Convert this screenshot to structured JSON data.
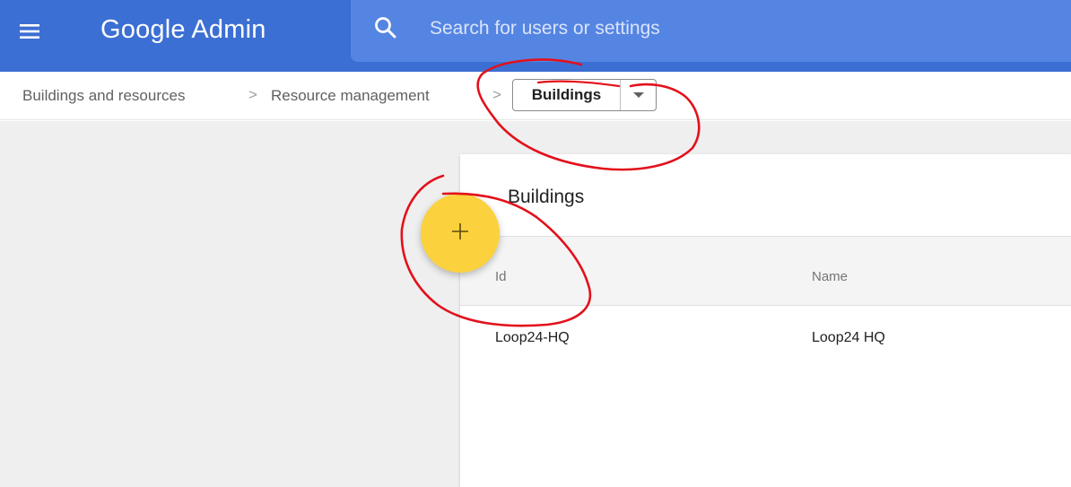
{
  "header": {
    "app_title": "Google Admin",
    "menu_icon": "hamburger-menu-icon",
    "search_icon": "search-icon",
    "search_placeholder": "Search for users or settings",
    "colors": {
      "bar": "#3c6fd3",
      "search_bg": "#5585e2"
    }
  },
  "breadcrumb": {
    "items": [
      "Buildings and resources",
      "Resource management"
    ],
    "separator": ">",
    "current": "Buildings",
    "dropdown_icon": "caret-down-icon"
  },
  "main": {
    "card_title": "Buildings",
    "add_button_icon": "plus-icon",
    "add_button_color": "#fbd23d",
    "table": {
      "columns": [
        "Id",
        "Name"
      ],
      "rows": [
        [
          "Loop24-HQ",
          "Loop24 HQ"
        ]
      ]
    }
  },
  "annotations": {
    "color": "#e3101a",
    "marks": [
      "circle-around-buildings-dropdown",
      "circle-around-add-button"
    ]
  }
}
